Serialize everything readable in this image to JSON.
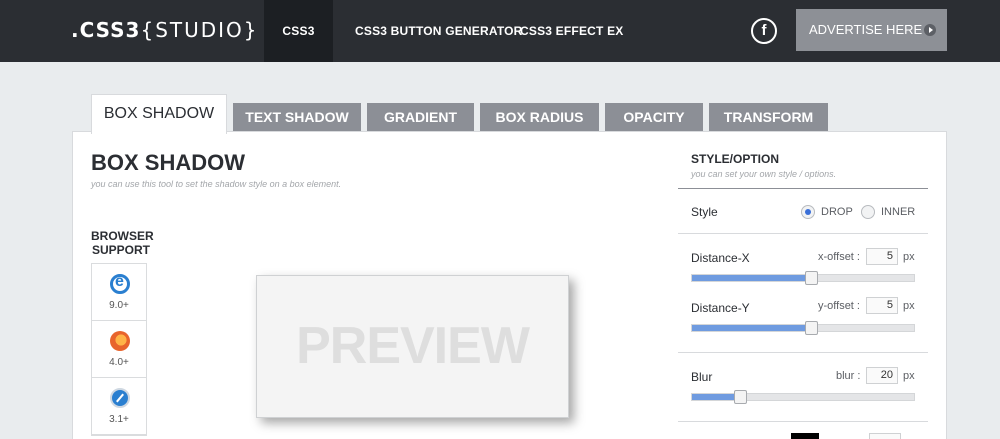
{
  "header": {
    "logo_prefix": ".CSS3",
    "logo_suffix": "{STUDIO}",
    "nav": [
      "CSS3",
      "CSS3 BUTTON GENERATOR",
      "CSS3 EFFECT EX"
    ],
    "facebook_icon": "f",
    "advertise_label": "ADVERTISE HERE"
  },
  "tabs": [
    "BOX SHADOW",
    "TEXT SHADOW",
    "GRADIENT",
    "BOX RADIUS",
    "OPACITY",
    "TRANSFORM"
  ],
  "main": {
    "title": "BOX SHADOW",
    "subtitle": "you can use this tool to set the shadow style on a box element.",
    "browser_support_label": "BROWSER SUPPORT",
    "browsers": [
      {
        "icon": "ie-icon",
        "version": "9.0+"
      },
      {
        "icon": "firefox-icon",
        "version": "4.0+"
      },
      {
        "icon": "safari-icon",
        "version": "3.1+"
      }
    ],
    "preview_text": "PREVIEW"
  },
  "options": {
    "title": "STYLE/OPTION",
    "subtitle": "you can set your own style / options.",
    "style_label": "Style",
    "style_options": [
      "DROP",
      "INNER"
    ],
    "style_selected": "DROP",
    "distance_x": {
      "label": "Distance-X",
      "offset_label": "x-offset :",
      "value": "5",
      "unit": "px",
      "slider_fraction": 0.52
    },
    "distance_y": {
      "label": "Distance-Y",
      "offset_label": "y-offset :",
      "value": "5",
      "unit": "px",
      "slider_fraction": 0.52
    },
    "blur": {
      "label": "Blur",
      "offset_label": "blur :",
      "value": "20",
      "unit": "px",
      "slider_fraction": 0.2
    }
  },
  "colors": {
    "topbar": "#2b2e33",
    "tab_inactive": "#8c8f96",
    "slider_fill": "#6f9be0",
    "radio_on": "#3a6fd8"
  }
}
